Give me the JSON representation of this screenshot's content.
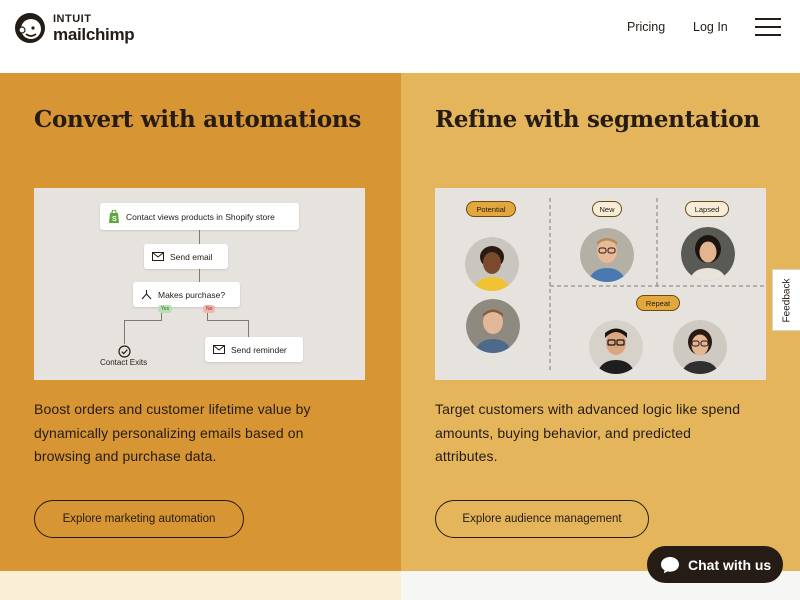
{
  "brand": {
    "line1": "INTUIT",
    "line2": "mailchimp"
  },
  "nav": {
    "pricing": "Pricing",
    "login": "Log In",
    "menu_icon": "hamburger-menu-icon"
  },
  "left": {
    "title": "Convert with automations",
    "flow": {
      "trigger": "Contact views products in Shopify store",
      "send_email": "Send email",
      "question": "Makes purchase?",
      "yes": "Yes",
      "no": "No",
      "exit": "Contact Exits",
      "reminder": "Send reminder"
    },
    "description": "Boost orders and customer lifetime value by dynamically personalizing emails based on browsing and purchase data.",
    "cta": "Explore marketing automation",
    "bg": "#d89533"
  },
  "right": {
    "title": "Refine with segmentation",
    "segments": {
      "potential": "Potential",
      "new": "New",
      "lapsed": "Lapsed",
      "repeat": "Repeat"
    },
    "description": "Target customers with advanced logic like spend amounts, buying behavior, and predicted attributes.",
    "cta": "Explore audience management",
    "bg": "#e5b55b"
  },
  "feedback": "Feedback",
  "chat": {
    "label": "Chat with us",
    "icon": "chat-bubble-icon"
  }
}
